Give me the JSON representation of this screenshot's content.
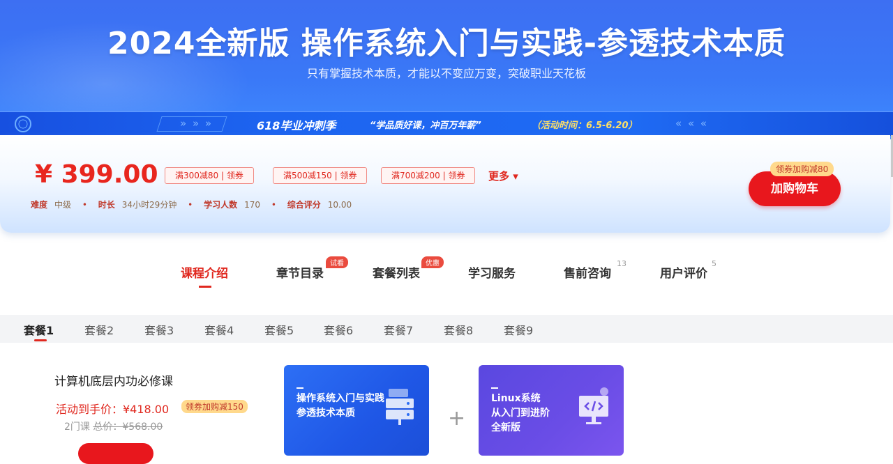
{
  "hero": {
    "title": "2024全新版 操作系统入门与实践-参透技术本质",
    "subtitle": "只有掌握技术本质，才能以不变应万变，突破职业天花板"
  },
  "promo": {
    "chevrons_right": "» » »",
    "chevrons_left": "« « «",
    "title": "618毕业冲刺季",
    "slogan": "“学品质好课，冲百万年薪”",
    "time": "（活动时间：6.5-6.20）"
  },
  "price_panel": {
    "price": "¥ 399.00",
    "coupons": [
      "满300减80 | 领券",
      "满500减150 | 领券",
      "满700减200 | 领券"
    ],
    "more_label": "更多 ▾",
    "meta": [
      {
        "key": "难度",
        "value": "中级"
      },
      {
        "key": "时长",
        "value": "34小时29分钟"
      },
      {
        "key": "学习人数",
        "value": "170"
      },
      {
        "key": "综合评分",
        "value": "10.00"
      }
    ],
    "cart_tip": "领券加购减80",
    "cart_label": "加购物车"
  },
  "tabs": [
    {
      "label": "课程介绍"
    },
    {
      "label": "章节目录",
      "badge": "试看"
    },
    {
      "label": "套餐列表",
      "badge": "优惠"
    },
    {
      "label": "学习服务"
    },
    {
      "label": "售前咨询",
      "count": "13"
    },
    {
      "label": "用户评价",
      "count": "5"
    }
  ],
  "packages": {
    "tabs": [
      "套餐1",
      "套餐2",
      "套餐3",
      "套餐4",
      "套餐5",
      "套餐6",
      "套餐7",
      "套餐8",
      "套餐9"
    ],
    "name": "计算机底层内功必修课",
    "price": "活动到手价：¥418.00",
    "tag": "领券加购减150",
    "count": "2门课",
    "orig_price": "总价：¥568.00",
    "cards": [
      {
        "line1": "操作系统入门与实践",
        "line2": "参透技术本质",
        "line3": ""
      },
      {
        "line1": "Linux系统",
        "line2": "从入门到进阶",
        "line3": "全新版"
      }
    ],
    "plus": "+"
  }
}
